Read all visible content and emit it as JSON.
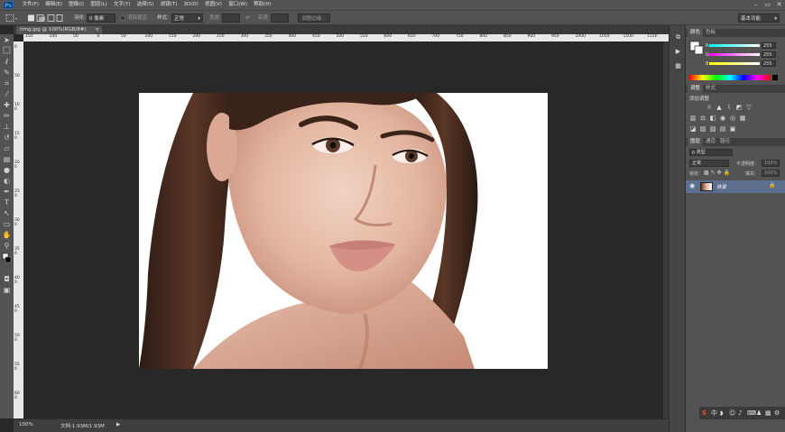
{
  "app": {
    "logo": "Ps"
  },
  "menu": [
    "文件(F)",
    "编辑(E)",
    "图像(I)",
    "图层(L)",
    "文字(Y)",
    "选择(S)",
    "滤镜(T)",
    "3D(D)",
    "视图(V)",
    "窗口(W)",
    "帮助(H)"
  ],
  "window_controls": {
    "minimize": "–",
    "restore": "▭",
    "close": "✕"
  },
  "options": {
    "feather_label": "羽化:",
    "feather_value": "0 像素",
    "antialias_label": "消除锯齿",
    "style_label": "样式:",
    "style_value": "正常",
    "width_label": "宽度:",
    "height_label": "高度:",
    "refine_button": "调整边缘...",
    "workspace": "基本功能"
  },
  "document": {
    "tab_title": "timg.jpg @ 100%(RGB/8#)",
    "tab_close": "×"
  },
  "rulers": {
    "h_ticks": [
      "150",
      "100",
      "50",
      "0",
      "50",
      "100",
      "150",
      "200",
      "250",
      "300",
      "350",
      "400",
      "450",
      "500",
      "550",
      "600",
      "650",
      "700",
      "750",
      "800",
      "850",
      "900",
      "950",
      "1000",
      "1050",
      "1100",
      "1150"
    ],
    "v_ticks": [
      "0",
      "50",
      "100",
      "150",
      "200",
      "250",
      "300",
      "350",
      "400",
      "450",
      "500",
      "550",
      "600"
    ]
  },
  "status": {
    "zoom": "100%",
    "doc_info": "文档:1.93M/1.93M",
    "arrow": "▶"
  },
  "color_panel": {
    "tabs": [
      "颜色",
      "色板"
    ],
    "channels": [
      {
        "label": "R",
        "value": "255"
      },
      {
        "label": "G",
        "value": "255"
      },
      {
        "label": "B",
        "value": "255"
      }
    ]
  },
  "adjust_panel": {
    "tabs": [
      "调整",
      "样式"
    ],
    "title": "添加调整"
  },
  "layers_panel": {
    "tabs": [
      "图层",
      "通道",
      "路径"
    ],
    "kind_label": "ρ 类型",
    "blend_mode": "正常",
    "opacity_label": "不透明度:",
    "opacity_value": "100%",
    "lock_label": "锁定:",
    "fill_label": "填充:",
    "fill_value": "100%",
    "layer_name": "背景"
  },
  "colors": {
    "accent": "#5c6f8e",
    "bg": "#282828",
    "panel": "#535353"
  }
}
